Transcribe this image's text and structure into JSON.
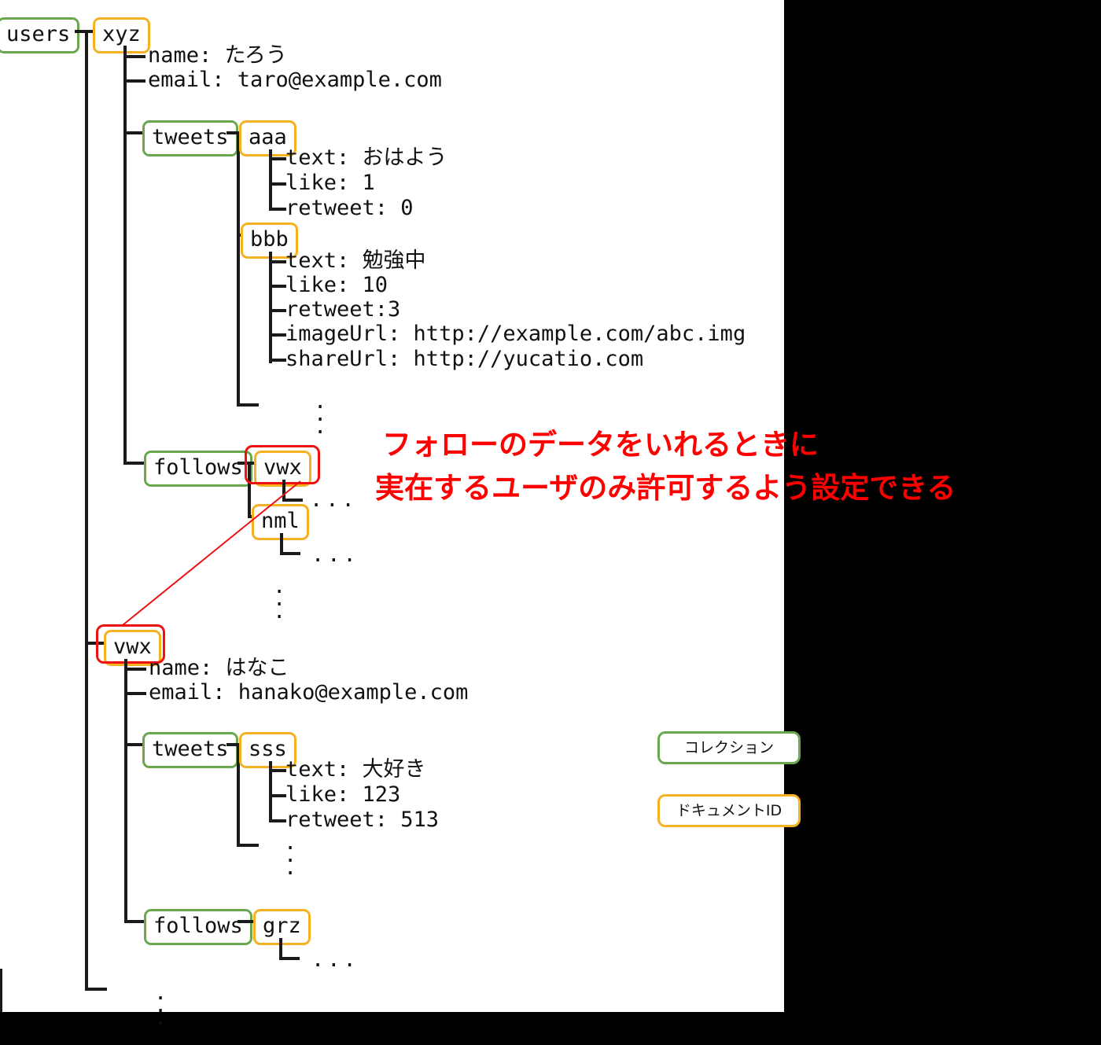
{
  "diagram": {
    "title": "Firestore users collection tree",
    "root": {
      "label": "users",
      "kind": "collection"
    },
    "colors": {
      "collection_border": "#6aa84f",
      "document_border": "#f5b122",
      "highlight": "#ee1111",
      "line": "#1a1a1a",
      "background": "#ffffff",
      "outside": "#000000"
    },
    "users": [
      {
        "id": "xyz",
        "fields": [
          "name: たろう",
          "email: taro@example.com"
        ],
        "subcollections": [
          {
            "name": "tweets",
            "documents": [
              {
                "id": "aaa",
                "fields": [
                  "text: おはよう",
                  "like: 1",
                  "retweet: 0"
                ]
              },
              {
                "id": "bbb",
                "fields": [
                  "text: 勉強中",
                  "like: 10",
                  "retweet:3",
                  "imageUrl: http://example.com/abc.img",
                  "shareUrl: http://yucatio.com"
                ]
              }
            ],
            "more": "⋮"
          },
          {
            "name": "follows",
            "documents": [
              {
                "id": "vwx",
                "fields": [],
                "ellipsis": "...",
                "highlighted": true
              },
              {
                "id": "nml",
                "fields": [],
                "ellipsis": "..."
              }
            ],
            "more": "⋮"
          }
        ]
      },
      {
        "id": "vwx",
        "highlighted": true,
        "fields": [
          "name: はなこ",
          "email: hanako@example.com"
        ],
        "subcollections": [
          {
            "name": "tweets",
            "documents": [
              {
                "id": "sss",
                "fields": [
                  "text: 大好き",
                  "like: 123",
                  "retweet: 513"
                ]
              }
            ],
            "more": "⋮"
          },
          {
            "name": "follows",
            "documents": [
              {
                "id": "grz",
                "fields": [],
                "ellipsis": "..."
              }
            ]
          }
        ]
      }
    ],
    "root_more": "⋮"
  },
  "annotation": {
    "line1": "フォローのデータをいれるときに",
    "line2": "実在するユーザのみ許可するよう設定できる"
  },
  "legend": {
    "collection_label": "コレクション",
    "document_label": "ドキュメントID"
  }
}
